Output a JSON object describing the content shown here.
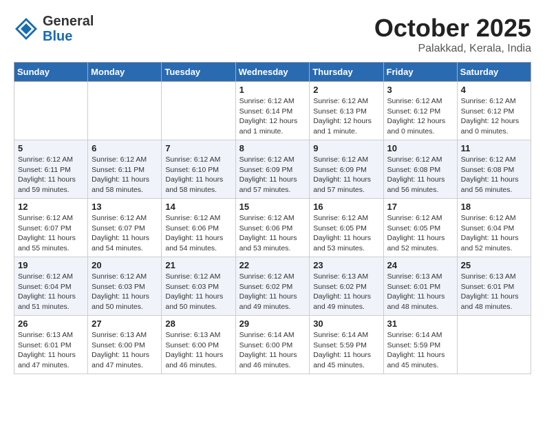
{
  "header": {
    "logo_general": "General",
    "logo_blue": "Blue",
    "month_title": "October 2025",
    "subtitle": "Palakkad, Kerala, India"
  },
  "weekdays": [
    "Sunday",
    "Monday",
    "Tuesday",
    "Wednesday",
    "Thursday",
    "Friday",
    "Saturday"
  ],
  "weeks": [
    [
      {
        "day": "",
        "info": ""
      },
      {
        "day": "",
        "info": ""
      },
      {
        "day": "",
        "info": ""
      },
      {
        "day": "1",
        "info": "Sunrise: 6:12 AM\nSunset: 6:14 PM\nDaylight: 12 hours\nand 1 minute."
      },
      {
        "day": "2",
        "info": "Sunrise: 6:12 AM\nSunset: 6:13 PM\nDaylight: 12 hours\nand 1 minute."
      },
      {
        "day": "3",
        "info": "Sunrise: 6:12 AM\nSunset: 6:12 PM\nDaylight: 12 hours\nand 0 minutes."
      },
      {
        "day": "4",
        "info": "Sunrise: 6:12 AM\nSunset: 6:12 PM\nDaylight: 12 hours\nand 0 minutes."
      }
    ],
    [
      {
        "day": "5",
        "info": "Sunrise: 6:12 AM\nSunset: 6:11 PM\nDaylight: 11 hours\nand 59 minutes."
      },
      {
        "day": "6",
        "info": "Sunrise: 6:12 AM\nSunset: 6:11 PM\nDaylight: 11 hours\nand 58 minutes."
      },
      {
        "day": "7",
        "info": "Sunrise: 6:12 AM\nSunset: 6:10 PM\nDaylight: 11 hours\nand 58 minutes."
      },
      {
        "day": "8",
        "info": "Sunrise: 6:12 AM\nSunset: 6:09 PM\nDaylight: 11 hours\nand 57 minutes."
      },
      {
        "day": "9",
        "info": "Sunrise: 6:12 AM\nSunset: 6:09 PM\nDaylight: 11 hours\nand 57 minutes."
      },
      {
        "day": "10",
        "info": "Sunrise: 6:12 AM\nSunset: 6:08 PM\nDaylight: 11 hours\nand 56 minutes."
      },
      {
        "day": "11",
        "info": "Sunrise: 6:12 AM\nSunset: 6:08 PM\nDaylight: 11 hours\nand 56 minutes."
      }
    ],
    [
      {
        "day": "12",
        "info": "Sunrise: 6:12 AM\nSunset: 6:07 PM\nDaylight: 11 hours\nand 55 minutes."
      },
      {
        "day": "13",
        "info": "Sunrise: 6:12 AM\nSunset: 6:07 PM\nDaylight: 11 hours\nand 54 minutes."
      },
      {
        "day": "14",
        "info": "Sunrise: 6:12 AM\nSunset: 6:06 PM\nDaylight: 11 hours\nand 54 minutes."
      },
      {
        "day": "15",
        "info": "Sunrise: 6:12 AM\nSunset: 6:06 PM\nDaylight: 11 hours\nand 53 minutes."
      },
      {
        "day": "16",
        "info": "Sunrise: 6:12 AM\nSunset: 6:05 PM\nDaylight: 11 hours\nand 53 minutes."
      },
      {
        "day": "17",
        "info": "Sunrise: 6:12 AM\nSunset: 6:05 PM\nDaylight: 11 hours\nand 52 minutes."
      },
      {
        "day": "18",
        "info": "Sunrise: 6:12 AM\nSunset: 6:04 PM\nDaylight: 11 hours\nand 52 minutes."
      }
    ],
    [
      {
        "day": "19",
        "info": "Sunrise: 6:12 AM\nSunset: 6:04 PM\nDaylight: 11 hours\nand 51 minutes."
      },
      {
        "day": "20",
        "info": "Sunrise: 6:12 AM\nSunset: 6:03 PM\nDaylight: 11 hours\nand 50 minutes."
      },
      {
        "day": "21",
        "info": "Sunrise: 6:12 AM\nSunset: 6:03 PM\nDaylight: 11 hours\nand 50 minutes."
      },
      {
        "day": "22",
        "info": "Sunrise: 6:12 AM\nSunset: 6:02 PM\nDaylight: 11 hours\nand 49 minutes."
      },
      {
        "day": "23",
        "info": "Sunrise: 6:13 AM\nSunset: 6:02 PM\nDaylight: 11 hours\nand 49 minutes."
      },
      {
        "day": "24",
        "info": "Sunrise: 6:13 AM\nSunset: 6:01 PM\nDaylight: 11 hours\nand 48 minutes."
      },
      {
        "day": "25",
        "info": "Sunrise: 6:13 AM\nSunset: 6:01 PM\nDaylight: 11 hours\nand 48 minutes."
      }
    ],
    [
      {
        "day": "26",
        "info": "Sunrise: 6:13 AM\nSunset: 6:01 PM\nDaylight: 11 hours\nand 47 minutes."
      },
      {
        "day": "27",
        "info": "Sunrise: 6:13 AM\nSunset: 6:00 PM\nDaylight: 11 hours\nand 47 minutes."
      },
      {
        "day": "28",
        "info": "Sunrise: 6:13 AM\nSunset: 6:00 PM\nDaylight: 11 hours\nand 46 minutes."
      },
      {
        "day": "29",
        "info": "Sunrise: 6:14 AM\nSunset: 6:00 PM\nDaylight: 11 hours\nand 46 minutes."
      },
      {
        "day": "30",
        "info": "Sunrise: 6:14 AM\nSunset: 5:59 PM\nDaylight: 11 hours\nand 45 minutes."
      },
      {
        "day": "31",
        "info": "Sunrise: 6:14 AM\nSunset: 5:59 PM\nDaylight: 11 hours\nand 45 minutes."
      },
      {
        "day": "",
        "info": ""
      }
    ]
  ]
}
